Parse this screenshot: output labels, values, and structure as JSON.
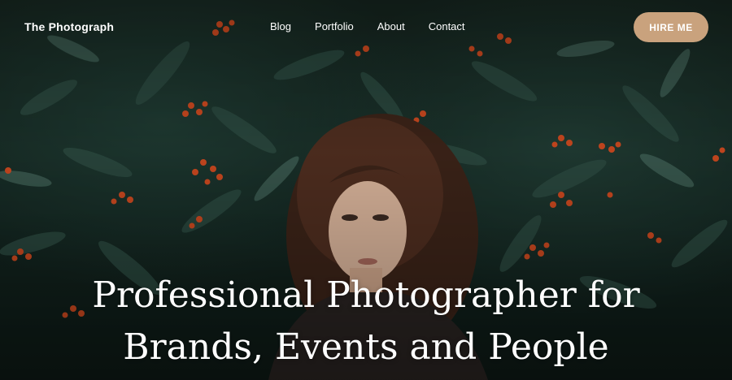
{
  "brand": "The Photograph",
  "nav": {
    "items": [
      "Blog",
      "Portfolio",
      "About",
      "Contact"
    ]
  },
  "cta": {
    "label": "HIRE ME",
    "color": "#c9a27d"
  },
  "hero": {
    "headline_line1": "Professional Photographer for",
    "headline_line2": "Brands, Events and People",
    "image_subject": "woman-among-rowan-berries"
  }
}
